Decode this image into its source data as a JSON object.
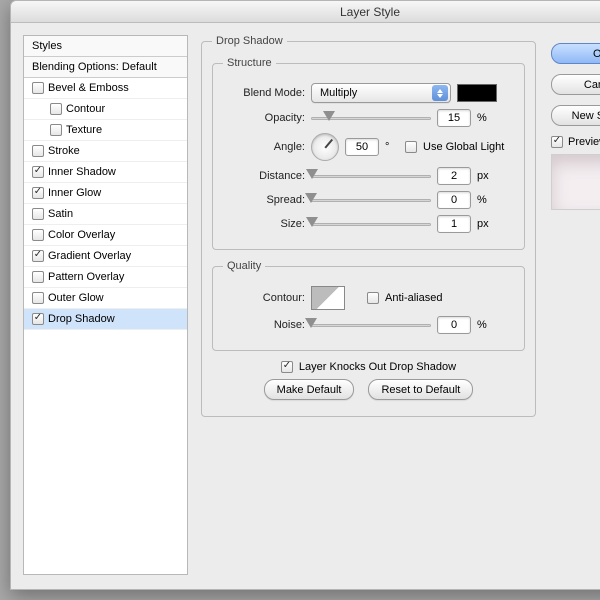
{
  "window": {
    "title": "Layer Style"
  },
  "sidebar": {
    "header": "Styles",
    "blending": "Blending Options: Default",
    "items": [
      {
        "label": "Bevel & Emboss",
        "checked": false,
        "indent": 0
      },
      {
        "label": "Contour",
        "checked": false,
        "indent": 1
      },
      {
        "label": "Texture",
        "checked": false,
        "indent": 1
      },
      {
        "label": "Stroke",
        "checked": false,
        "indent": 0
      },
      {
        "label": "Inner Shadow",
        "checked": true,
        "indent": 0
      },
      {
        "label": "Inner Glow",
        "checked": true,
        "indent": 0
      },
      {
        "label": "Satin",
        "checked": false,
        "indent": 0
      },
      {
        "label": "Color Overlay",
        "checked": false,
        "indent": 0
      },
      {
        "label": "Gradient Overlay",
        "checked": true,
        "indent": 0
      },
      {
        "label": "Pattern Overlay",
        "checked": false,
        "indent": 0
      },
      {
        "label": "Outer Glow",
        "checked": false,
        "indent": 0
      },
      {
        "label": "Drop Shadow",
        "checked": true,
        "indent": 0,
        "selected": true
      }
    ]
  },
  "panel": {
    "title": "Drop Shadow",
    "structure_legend": "Structure",
    "blend_mode_label": "Blend Mode:",
    "blend_mode_value": "Multiply",
    "color_swatch": "#000000",
    "opacity_label": "Opacity:",
    "opacity_value": "15",
    "opacity_unit": "%",
    "angle_label": "Angle:",
    "angle_value": "50",
    "angle_unit": "°",
    "global_light_label": "Use Global Light",
    "global_light_checked": false,
    "distance_label": "Distance:",
    "distance_value": "2",
    "distance_unit": "px",
    "spread_label": "Spread:",
    "spread_value": "0",
    "spread_unit": "%",
    "size_label": "Size:",
    "size_value": "1",
    "size_unit": "px",
    "quality_legend": "Quality",
    "contour_label": "Contour:",
    "antialiased_label": "Anti-aliased",
    "antialiased_checked": false,
    "noise_label": "Noise:",
    "noise_value": "0",
    "noise_unit": "%",
    "knockout_label": "Layer Knocks Out Drop Shadow",
    "knockout_checked": true,
    "make_default": "Make Default",
    "reset_default": "Reset to Default"
  },
  "right": {
    "ok": "OK",
    "cancel": "Cancel",
    "new_style": "New Style...",
    "preview_label": "Preview",
    "preview_checked": true
  }
}
